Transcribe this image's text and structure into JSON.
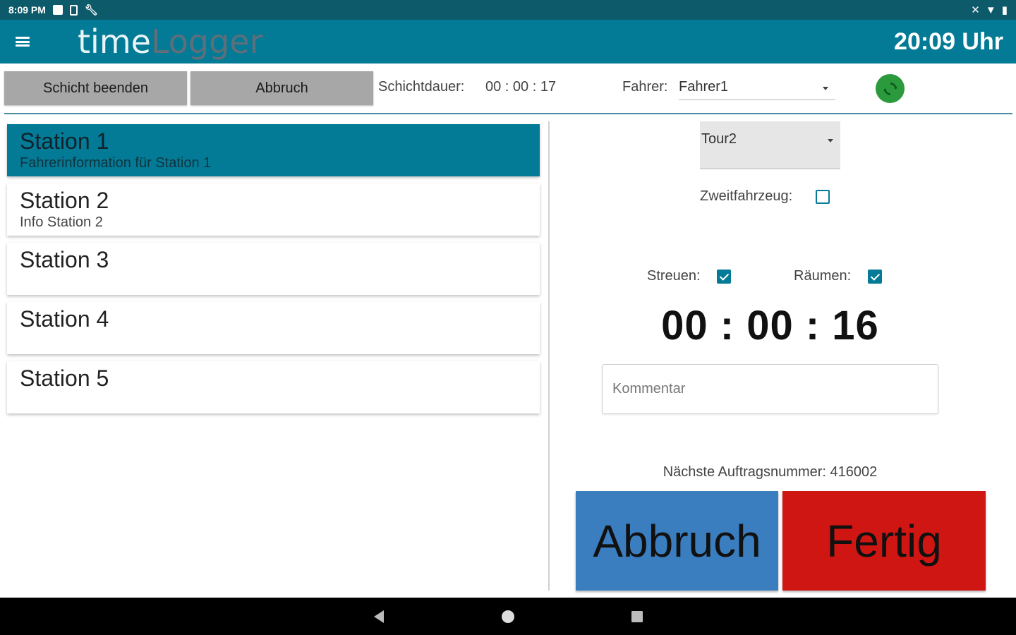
{
  "status_bar": {
    "time": "8:09 PM"
  },
  "app_bar": {
    "title_part1": "time",
    "title_part2": "Logger",
    "clock": "20:09 Uhr"
  },
  "toolbar": {
    "end_shift_label": "Schicht beenden",
    "abort_label": "Abbruch",
    "duration_label": "Schichtdauer:",
    "duration_value": "00 : 00 : 17",
    "driver_label": "Fahrer:",
    "driver_value": "Fahrer1"
  },
  "stations": [
    {
      "name": "Station 1",
      "info": "Fahrerinformation für Station 1",
      "selected": true
    },
    {
      "name": "Station 2",
      "info": "Info Station 2",
      "selected": false
    },
    {
      "name": "Station 3",
      "info": "",
      "selected": false
    },
    {
      "name": "Station 4",
      "info": "",
      "selected": false
    },
    {
      "name": "Station 5",
      "info": "",
      "selected": false
    }
  ],
  "detail": {
    "tour_value": "Tour2",
    "second_vehicle_label": "Zweitfahrzeug:",
    "second_vehicle_checked": false,
    "spread_label": "Streuen:",
    "spread_checked": true,
    "clear_label": "Räumen:",
    "clear_checked": true,
    "timer": "00 : 00 : 16",
    "comment_placeholder": "Kommentar",
    "comment_value": "",
    "next_order": "Nächste Auftragsnummer: 416002",
    "abort_label": "Abbruch",
    "done_label": "Fertig"
  },
  "colors": {
    "primary": "#037a96",
    "status_bar": "#0d5a6b",
    "abort_button": "#3a7ec0",
    "done_button": "#d01612",
    "sync_button": "#2a9a3c"
  }
}
